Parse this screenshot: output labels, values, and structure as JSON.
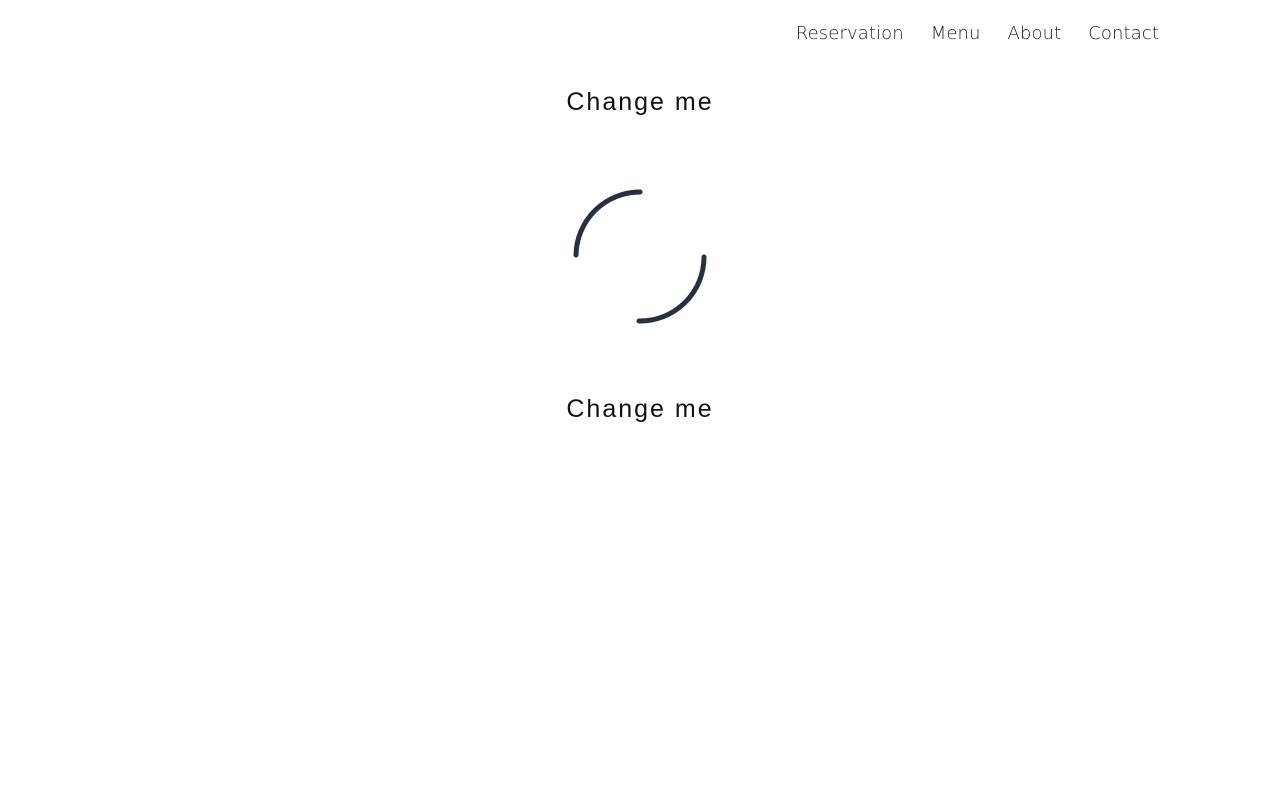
{
  "nav": {
    "items": [
      {
        "label": "Reservation"
      },
      {
        "label": "Menu"
      },
      {
        "label": "About"
      },
      {
        "label": "Contact"
      }
    ]
  },
  "main": {
    "heading_top": "Change me",
    "heading_bottom": "Change me",
    "spinner": {
      "icon": "loading-spinner-icon",
      "color": "#28303e"
    }
  },
  "colors": {
    "background": "#ffffff",
    "text": "#111111",
    "spinner": "#28303e"
  }
}
